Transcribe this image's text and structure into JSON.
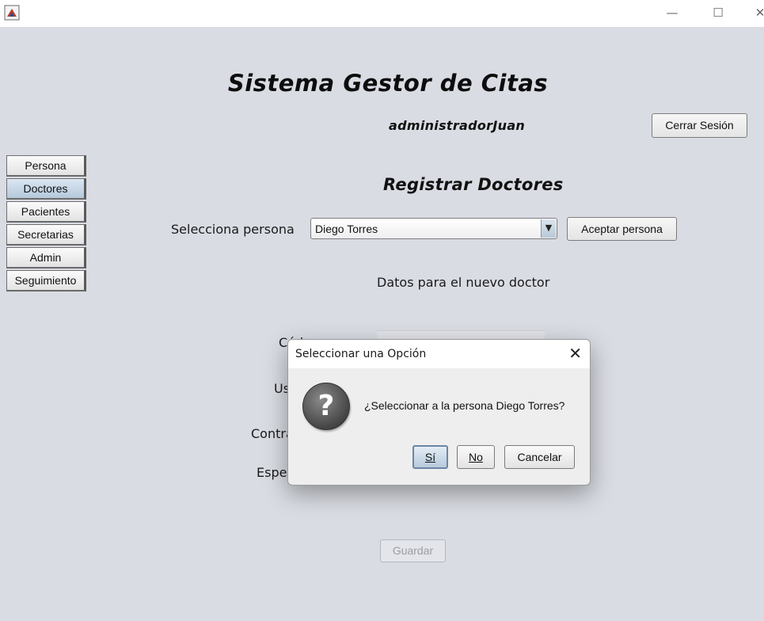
{
  "window": {
    "minimize": "—",
    "maximize": "☐",
    "close": "✕"
  },
  "app": {
    "title": "Sistema Gestor de Citas",
    "user": "administradorJuan",
    "logout_label": "Cerrar Sesión"
  },
  "sidebar": {
    "items": [
      {
        "label": "Persona"
      },
      {
        "label": "Doctores",
        "active": true
      },
      {
        "label": "Pacientes"
      },
      {
        "label": "Secretarias"
      },
      {
        "label": "Admin"
      },
      {
        "label": "Seguimiento"
      }
    ]
  },
  "form": {
    "section_title": "Registrar Doctores",
    "select_person_label": "Selecciona persona",
    "selected_person": "Diego Torres",
    "accept_button": "Aceptar persona",
    "subtitle": "Datos para el nuevo doctor",
    "field_labels": [
      "Céd",
      "Us",
      "Contra",
      "Espec"
    ],
    "save_button": "Guardar"
  },
  "dialog": {
    "title": "Seleccionar una Opción",
    "close": "✕",
    "icon": "question-icon",
    "message": "¿Seleccionar a la persona Diego Torres?",
    "yes": "Sí",
    "no": "No",
    "cancel": "Cancelar"
  }
}
